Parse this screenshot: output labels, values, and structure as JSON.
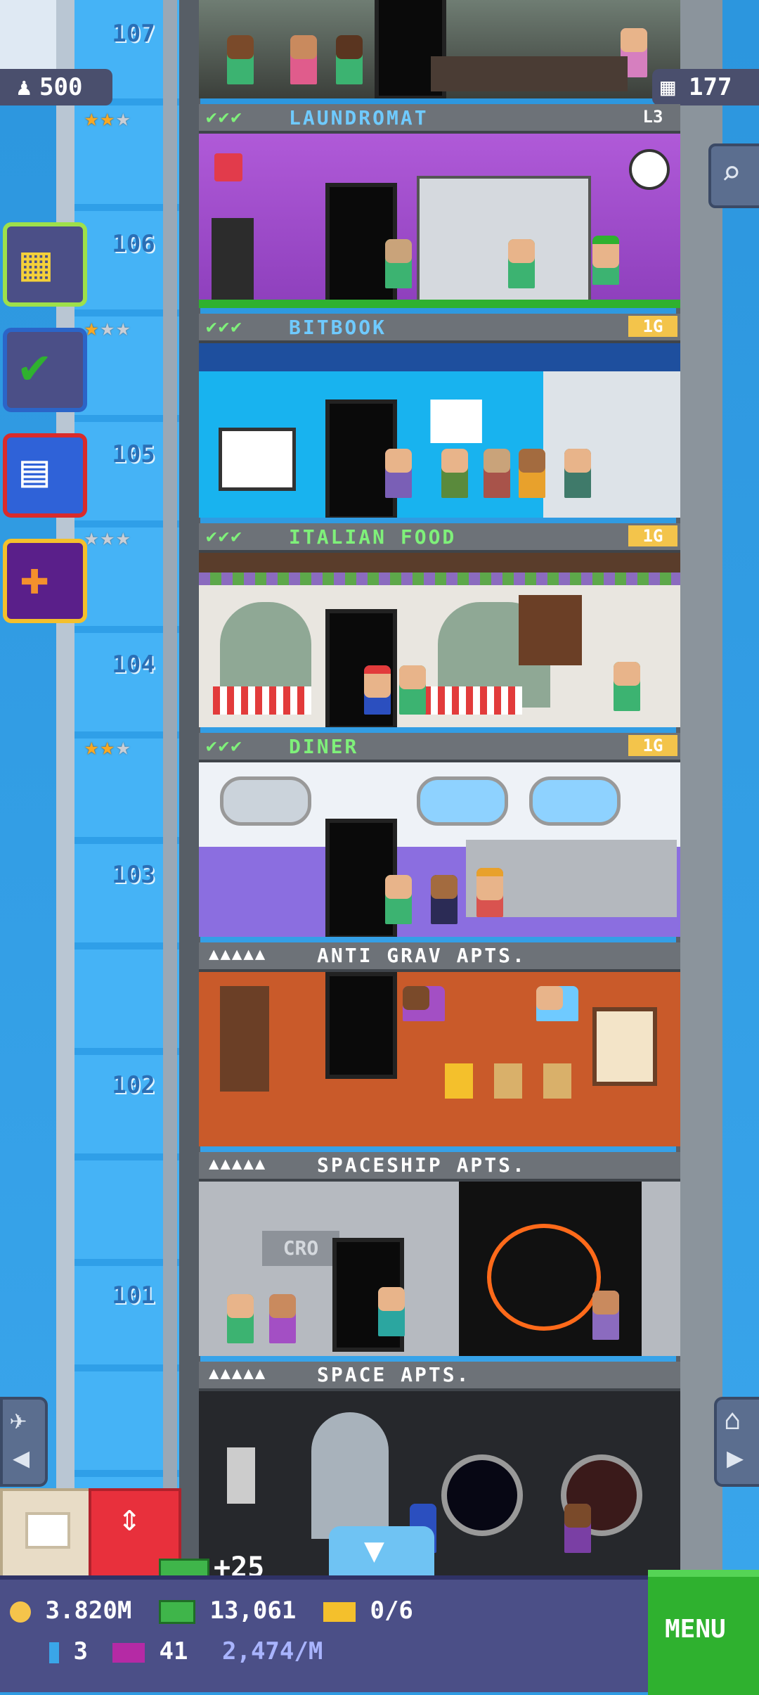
{
  "top_stats": {
    "population": "500",
    "floors": "177"
  },
  "floor_numbers": [
    "107",
    "106",
    "105",
    "104",
    "103",
    "102",
    "101"
  ],
  "floors": [
    {
      "name": "LAUNDROMAT",
      "level": "L3",
      "checks": "✔✔✔",
      "stars": [
        1,
        1,
        0
      ],
      "color": "#6fcaff"
    },
    {
      "name": "BITBOOK",
      "level": "1G",
      "checks": "✔✔✔",
      "stars": [
        1,
        0,
        0
      ],
      "color": "#6fcaff"
    },
    {
      "name": "ITALIAN FOOD",
      "level": "1G",
      "checks": "✔✔✔",
      "stars": [
        0,
        0,
        0
      ],
      "color": "#7ff07a"
    },
    {
      "name": "DINER",
      "level": "1G",
      "checks": "✔✔✔",
      "stars": [
        1,
        1,
        0
      ],
      "color": "#7ff07a"
    }
  ],
  "apartments": [
    {
      "name": "ANTI GRAV APTS.",
      "dots": "▲▲▲▲▲"
    },
    {
      "name": "SPACESHIP APTS.",
      "dots": "▲▲▲▲▲"
    },
    {
      "name": "SPACE APTS.",
      "dots": "▲▲▲▲▲"
    }
  ],
  "room_labels": {
    "cro_sign": "CRO"
  },
  "bux_gain": "+25",
  "hud": {
    "coins": "3.820M",
    "bux": "13,061",
    "tickets": "0/6",
    "elevators": "3",
    "vip": "41",
    "income": "2,474/M",
    "menu_label": "MENU"
  },
  "icons": {
    "population": "person-icon",
    "floors": "building-icon",
    "search": "magnifier-icon",
    "visit": "plane-icon",
    "home": "house-icon"
  },
  "colors": {
    "gold_star": "#f7a824",
    "grey_star": "#c9ced6",
    "menu_green": "#2fb12f",
    "hud_purple": "#4b4f87"
  }
}
